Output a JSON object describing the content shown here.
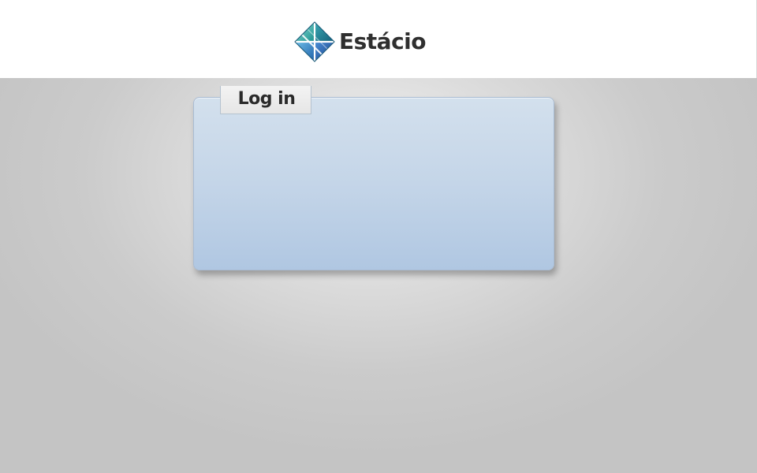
{
  "header": {
    "brand_name": "Estácio",
    "logo_icon": "estacio-diamond-logo-icon"
  },
  "login": {
    "tab_label": "Log in"
  },
  "colors": {
    "brand_teal": "#1f9aa6",
    "brand_blue": "#2c6fb5",
    "panel_top": "#d3e0ed",
    "panel_bottom": "#b0c7e2",
    "background": "#c4c4c4"
  }
}
